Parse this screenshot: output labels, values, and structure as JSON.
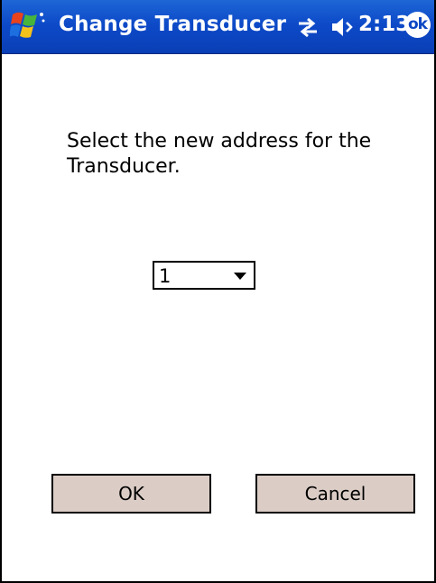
{
  "titlebar": {
    "title": "Change Transducer",
    "clock": "2:13",
    "ok_label": "ok",
    "icons": [
      "windows-start-flag-icon",
      "connectivity-icon",
      "volume-icon"
    ]
  },
  "dialog": {
    "prompt": "Select the new address for the Transducer.",
    "address_select": {
      "selected_value": "1"
    },
    "ok_button": "OK",
    "cancel_button": "Cancel"
  },
  "colors": {
    "titlebar": "#0d4ac8",
    "button_face": "#dbcdc6",
    "background": "#ffffff"
  }
}
